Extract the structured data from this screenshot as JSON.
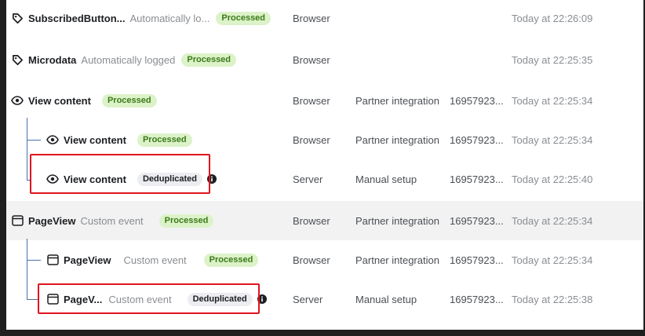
{
  "rows": [
    {
      "name": "SubscribedButton...",
      "sub": "Automatically lo...",
      "badge": "Processed",
      "source": "Browser",
      "setup": "",
      "id": "",
      "time": "Today at 22:26:09"
    },
    {
      "name": "Microdata",
      "sub": "Automatically logged",
      "badge": "Processed",
      "source": "Browser",
      "setup": "",
      "id": "",
      "time": "Today at 22:25:35"
    },
    {
      "name": "View content",
      "sub": "",
      "badge": "Processed",
      "source": "Browser",
      "setup": "Partner integration",
      "id": "16957923...",
      "time": "Today at 22:25:34"
    },
    {
      "name": "View content",
      "sub": "",
      "badge": "Processed",
      "source": "Browser",
      "setup": "Partner integration",
      "id": "16957923...",
      "time": "Today at 22:25:34"
    },
    {
      "name": "View content",
      "sub": "",
      "badge": "Deduplicated",
      "source": "Server",
      "setup": "Manual setup",
      "id": "16957923...",
      "time": "Today at 22:25:40"
    },
    {
      "name": "PageView",
      "sub": "Custom event",
      "badge": "Processed",
      "source": "Browser",
      "setup": "Partner integration",
      "id": "16957923...",
      "time": "Today at 22:25:34"
    },
    {
      "name": "PageView",
      "sub": "Custom event",
      "badge": "Processed",
      "source": "Browser",
      "setup": "Partner integration",
      "id": "16957923...",
      "time": "Today at 22:25:34"
    },
    {
      "name": "PageV...",
      "sub": "Custom event",
      "badge": "Deduplicated",
      "source": "Server",
      "setup": "Manual setup",
      "id": "16957923...",
      "time": "Today at 22:25:38"
    }
  ],
  "icons": {
    "tag": "tag-icon",
    "eye": "eye-icon",
    "window": "window-icon",
    "info": "info-icon"
  },
  "colors": {
    "processed_bg": "#dcf2c8",
    "processed_text": "#3b7a1a",
    "dedup_bg": "#ebedf0",
    "highlight": "#e0141e",
    "tree_line": "#4a6fb0"
  }
}
